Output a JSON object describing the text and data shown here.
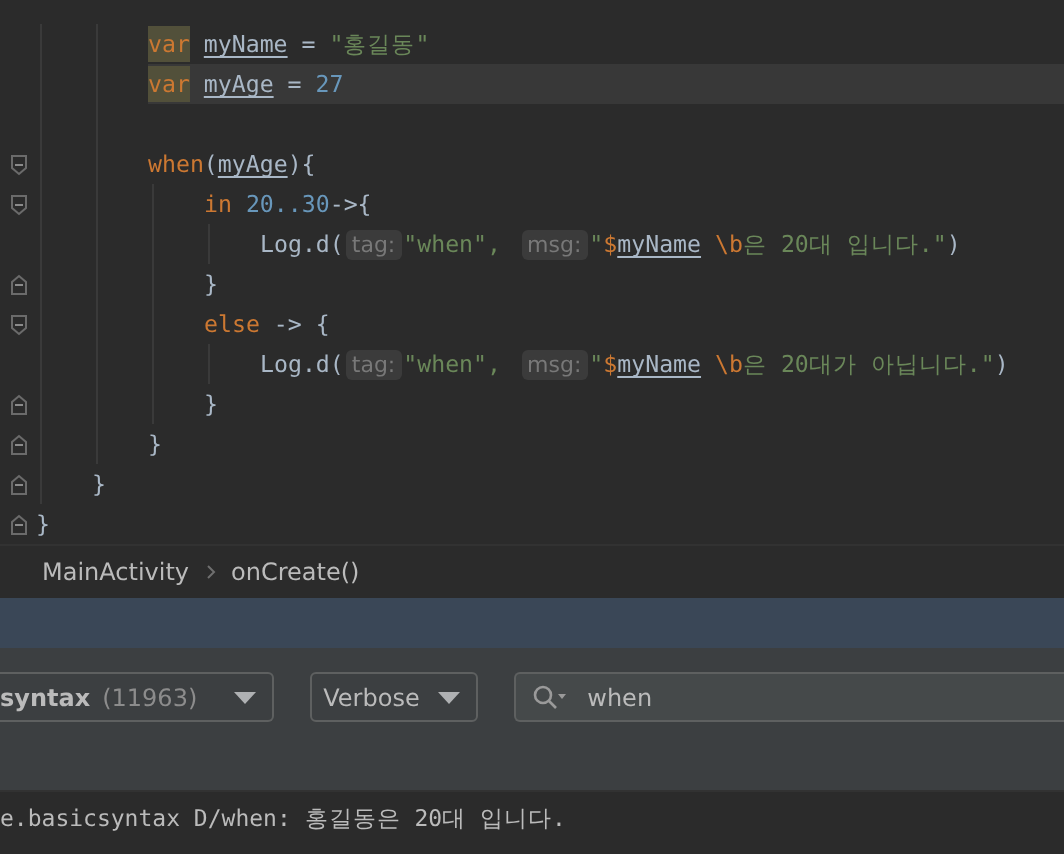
{
  "editor": {
    "lines": [
      {
        "kind": "block",
        "children": [
          {
            "kind": "block",
            "children": [
              {
                "kind": "code",
                "current": false,
                "foldable": false,
                "tokens": [
                  {
                    "kind": "kwm",
                    "s": "var"
                  },
                  {
                    "kind": "id",
                    "s": "myName"
                  },
                  {
                    "kind": "op",
                    "s": " = "
                  },
                  {
                    "kind": "str",
                    "s": "\"홍길동\""
                  }
                ]
              },
              {
                "kind": "code",
                "current": true,
                "foldable": false,
                "tokens": [
                  {
                    "kind": "kwm",
                    "s": "var"
                  },
                  {
                    "kind": "id",
                    "s": "myAge"
                  },
                  {
                    "kind": "op",
                    "s": " = "
                  },
                  {
                    "kind": "num",
                    "s": "27"
                  }
                ]
              },
              {
                "kind": "blank"
              },
              {
                "kind": "code",
                "current": false,
                "foldable": true,
                "tokens": [
                  {
                    "kind": "kw",
                    "s": "when"
                  },
                  {
                    "kind": "op",
                    "s": "("
                  },
                  {
                    "kind": "id",
                    "s": "myAge"
                  },
                  {
                    "kind": "op",
                    "s": "){"
                  }
                ],
                "children": [
                  {
                    "kind": "code",
                    "current": false,
                    "foldable": true,
                    "tokens": [
                      {
                        "kind": "kw",
                        "s": "in"
                      },
                      {
                        "kind": "num",
                        "s": " 20..30"
                      },
                      {
                        "kind": "op",
                        "s": "->{"
                      }
                    ],
                    "children": [
                      {
                        "kind": "code",
                        "current": false,
                        "foldable": false,
                        "tokens": [
                          {
                            "kind": "op",
                            "s": "Log.d("
                          },
                          {
                            "kind": "hint",
                            "s": "tag:"
                          },
                          {
                            "kind": "str",
                            "s": "\"when\","
                          },
                          {
                            "kind": "hint",
                            "s": "msg:"
                          },
                          {
                            "kind": "str",
                            "s": "\""
                          },
                          {
                            "kind": "esc",
                            "s": "$"
                          },
                          {
                            "kind": "id",
                            "s": "myName"
                          },
                          {
                            "kind": "esc",
                            "s": " \\b"
                          },
                          {
                            "kind": "str",
                            "s": "은 20대 입니다.\""
                          },
                          {
                            "kind": "op",
                            "s": ")"
                          }
                        ]
                      }
                    ]
                  },
                  {
                    "kind": "code",
                    "current": false,
                    "foldable": true,
                    "tokens": [
                      {
                        "kind": "op",
                        "s": "}"
                      }
                    ]
                  },
                  {
                    "kind": "code",
                    "current": false,
                    "foldable": true,
                    "tokens": [
                      {
                        "kind": "kw",
                        "s": "else"
                      },
                      {
                        "kind": "op",
                        "s": " -> {"
                      }
                    ],
                    "children": [
                      {
                        "kind": "code",
                        "current": false,
                        "foldable": false,
                        "tokens": [
                          {
                            "kind": "op",
                            "s": "Log.d("
                          },
                          {
                            "kind": "hint",
                            "s": "tag:"
                          },
                          {
                            "kind": "str",
                            "s": "\"when\","
                          },
                          {
                            "kind": "hint",
                            "s": "msg:"
                          },
                          {
                            "kind": "str",
                            "s": "\""
                          },
                          {
                            "kind": "esc",
                            "s": "$"
                          },
                          {
                            "kind": "id",
                            "s": "myName"
                          },
                          {
                            "kind": "esc",
                            "s": " \\b"
                          },
                          {
                            "kind": "str",
                            "s": "은 20대가 아닙니다.\""
                          },
                          {
                            "kind": "op",
                            "s": ")"
                          }
                        ]
                      }
                    ]
                  },
                  {
                    "kind": "code",
                    "current": false,
                    "foldable": true,
                    "tokens": [
                      {
                        "kind": "op",
                        "s": "}"
                      }
                    ]
                  }
                ]
              },
              {
                "kind": "code",
                "current": false,
                "foldable": true,
                "tokens": [
                  {
                    "kind": "op",
                    "s": "}"
                  }
                ]
              }
            ]
          },
          {
            "kind": "code",
            "current": false,
            "foldable": true,
            "tokens": [
              {
                "kind": "op",
                "s": "}"
              }
            ]
          }
        ]
      },
      {
        "kind": "code",
        "current": false,
        "foldable": true,
        "tokens": [
          {
            "kind": "op",
            "s": "}"
          }
        ]
      }
    ]
  },
  "breadcrumb": [
    "MainActivity",
    "onCreate()"
  ],
  "logcat": {
    "process_filter": {
      "name": "syntax",
      "count": "(11963)"
    },
    "level_filter": "Verbose",
    "search": {
      "value": "when"
    },
    "output": [
      "e.basicsyntax D/when: 홍길동은 20대 입니다."
    ]
  }
}
